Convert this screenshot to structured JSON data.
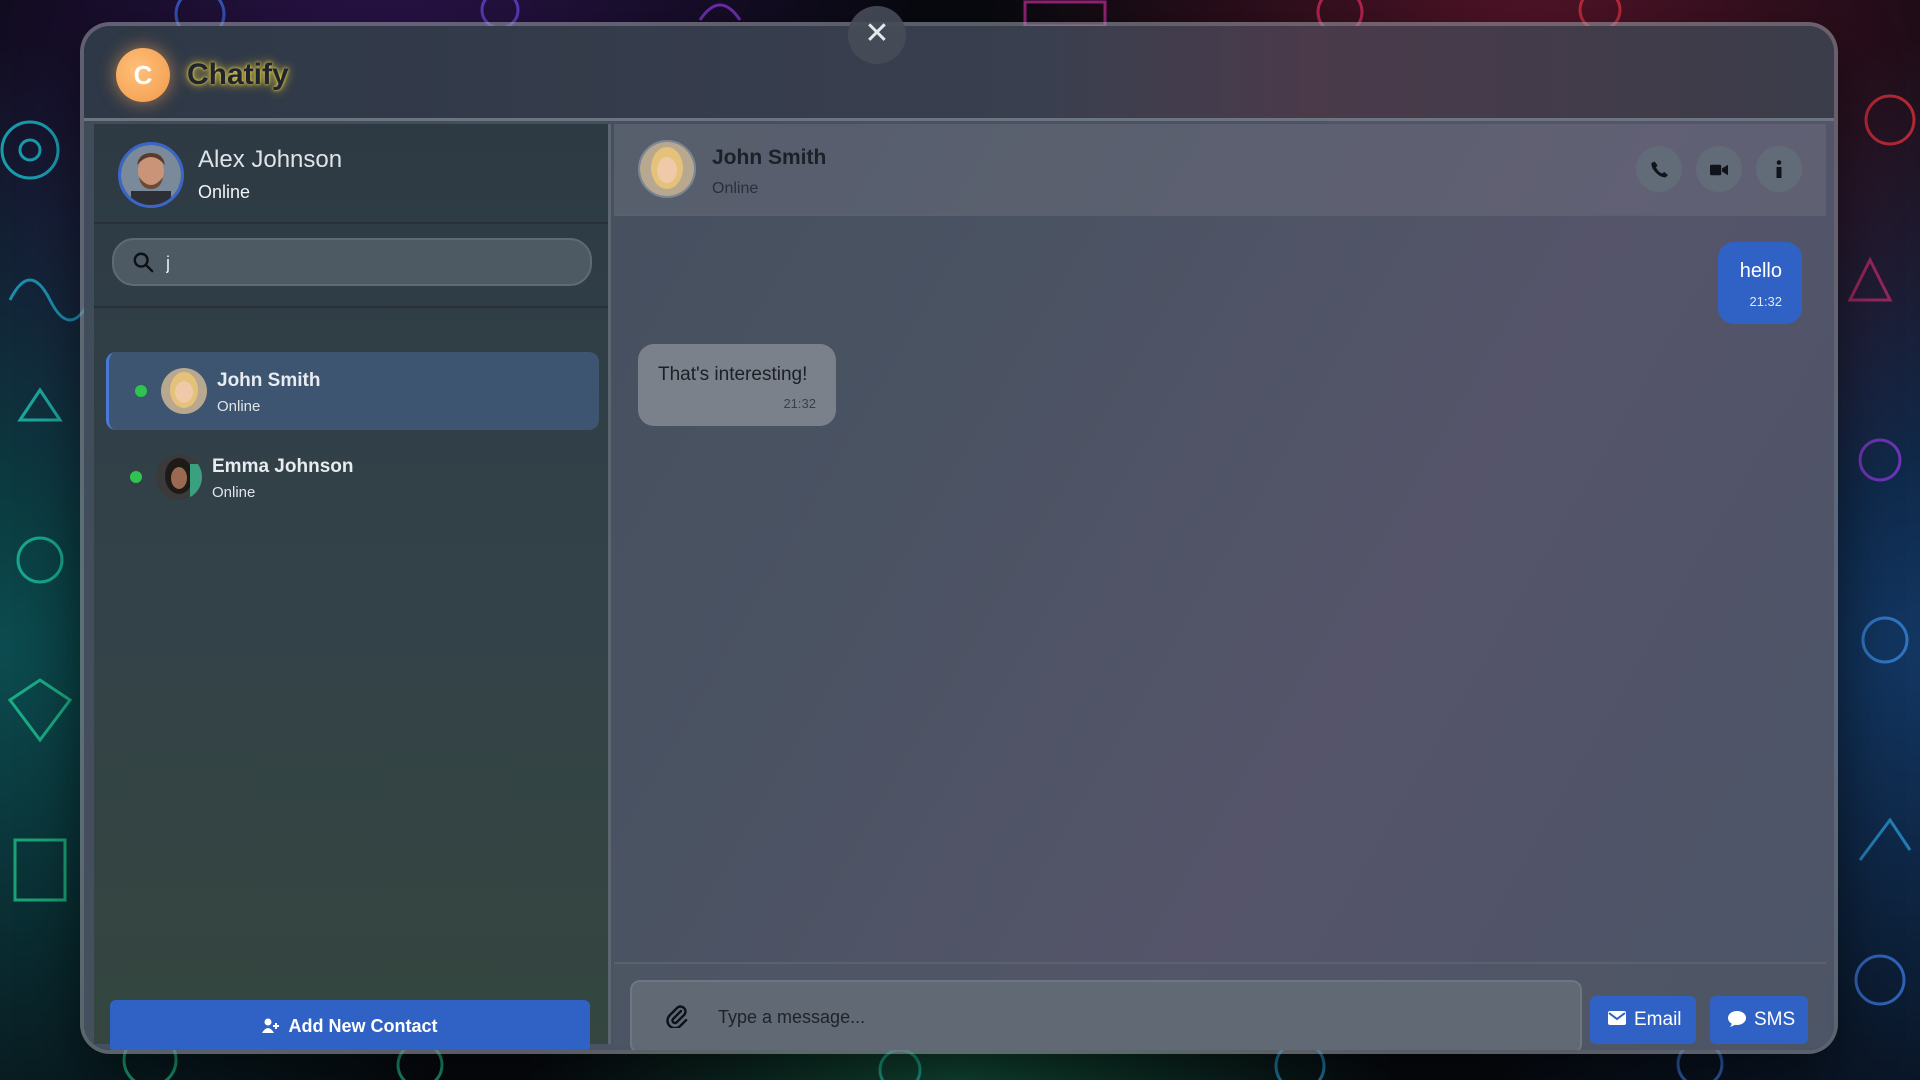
{
  "app": {
    "logo_letter": "C",
    "name": "Chatify",
    "close_glyph": "✕"
  },
  "current_user": {
    "name": "Alex Johnson",
    "status": "Online"
  },
  "search": {
    "value": "j",
    "placeholder": ""
  },
  "contacts": [
    {
      "name": "John Smith",
      "status": "Online",
      "active": true,
      "presence_color": "#2ec44f"
    },
    {
      "name": "Emma Johnson",
      "status": "Online",
      "active": false,
      "presence_color": "#2ec44f"
    }
  ],
  "add_contact": {
    "label": "Add New Contact"
  },
  "chat": {
    "header": {
      "name": "John Smith",
      "status": "Online"
    },
    "actions": [
      "phone-icon",
      "video-icon",
      "info-icon"
    ],
    "messages": [
      {
        "direction": "outgoing",
        "text": "hello",
        "time": "21:32"
      },
      {
        "direction": "incoming",
        "text": "That's interesting!",
        "time": "21:32"
      }
    ]
  },
  "composer": {
    "placeholder": "Type a message...",
    "email_label": "Email",
    "sms_label": "SMS"
  },
  "colors": {
    "accent": "#2f62c4",
    "online": "#2ec44f",
    "logo": "#f29a4a"
  }
}
